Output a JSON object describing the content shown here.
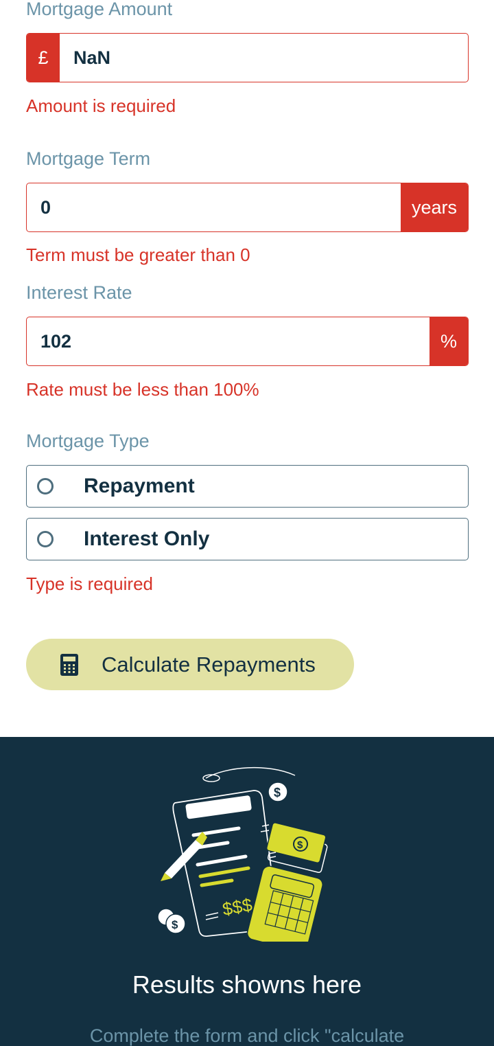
{
  "form": {
    "amount": {
      "label": "Mortgage Amount",
      "prefix": "£",
      "value": "NaN",
      "error": "Amount is required"
    },
    "term": {
      "label": "Mortgage Term",
      "value": "0",
      "suffix": "years",
      "error": "Term must be greater than 0"
    },
    "rate": {
      "label": "Interest Rate",
      "value": "102",
      "suffix": "%",
      "error": "Rate must be less than 100%"
    },
    "type": {
      "label": "Mortgage Type",
      "options": [
        {
          "label": "Repayment",
          "selected": false
        },
        {
          "label": "Interest Only",
          "selected": false
        }
      ],
      "error": "Type is required"
    },
    "submit_label": "Calculate Repayments",
    "submit_icon": "calculator-icon"
  },
  "results": {
    "title": "Results showns here",
    "subtitle": "Complete the form and click \"calculate",
    "illustration": "empty-results-illustration"
  },
  "colors": {
    "error_red": "#d73328",
    "label_slate": "#6b94a8",
    "dark_navy": "#133041",
    "lime": "#d8db2f",
    "button_bg": "#e2e2a4"
  }
}
